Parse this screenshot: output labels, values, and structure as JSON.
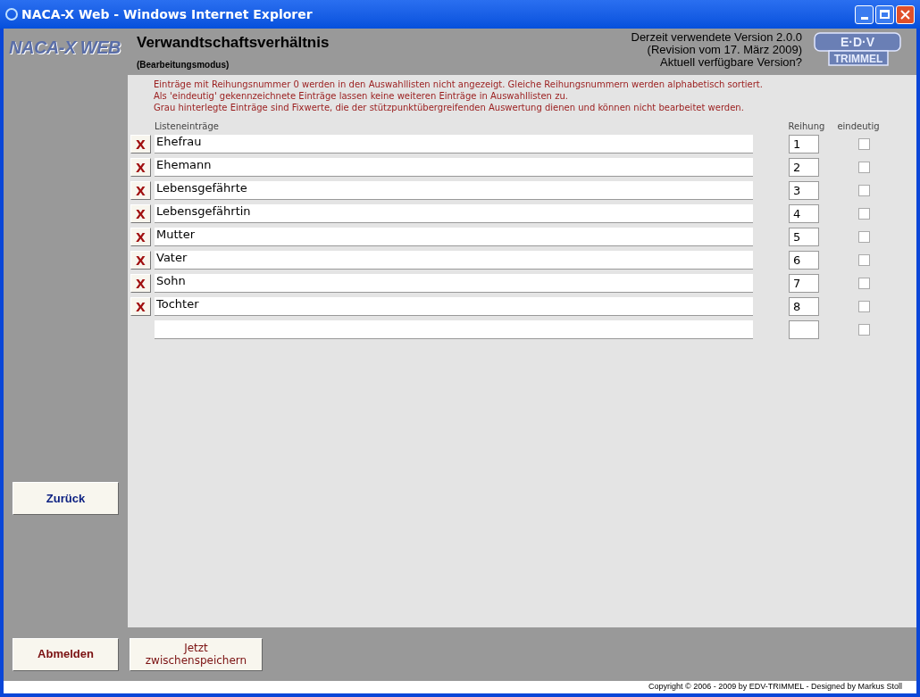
{
  "window": {
    "title": "NACA-X Web - Windows Internet Explorer"
  },
  "header": {
    "logo": "NACA-X WEB",
    "title": "Verwandtschaftsverhältnis",
    "subtitle": "(Bearbeitungsmodus)",
    "version_lines": [
      "Derzeit verwendete Version 2.0.0",
      "(Revision vom 17. März 2009)",
      "Aktuell verfügbare Version?"
    ],
    "company_logo": {
      "top": "E·D·V",
      "bottom": "TRIMMEL"
    }
  },
  "notes": [
    "Einträge mit Reihungsnummer 0 werden in den Auswahllisten nicht angezeigt. Gleiche Reihungsnummern werden alphabetisch sortiert.",
    "Als 'eindeutig' gekennzeichnete Einträge lassen keine weiteren Einträge in Auswahllisten zu.",
    "Grau hinterlegte Einträge sind Fixwerte, die der stützpunktübergreifenden Auswertung dienen und können nicht bearbeitet werden."
  ],
  "table": {
    "columns": [
      "Listeneinträge",
      "Reihung",
      "eindeutig"
    ],
    "rows": [
      {
        "delete": "X",
        "entry": "Ehefrau",
        "rank": "1",
        "unique": false
      },
      {
        "delete": "X",
        "entry": "Ehemann",
        "rank": "2",
        "unique": false
      },
      {
        "delete": "X",
        "entry": "Lebensgefährte",
        "rank": "3",
        "unique": false
      },
      {
        "delete": "X",
        "entry": "Lebensgefährtin",
        "rank": "4",
        "unique": false
      },
      {
        "delete": "X",
        "entry": "Mutter",
        "rank": "5",
        "unique": false
      },
      {
        "delete": "X",
        "entry": "Vater",
        "rank": "6",
        "unique": false
      },
      {
        "delete": "X",
        "entry": "Sohn",
        "rank": "7",
        "unique": false
      },
      {
        "delete": "X",
        "entry": "Tochter",
        "rank": "8",
        "unique": false
      },
      {
        "unique": false
      }
    ]
  },
  "buttons": {
    "back": "Zurück",
    "logout": "Abmelden",
    "save": "Jetzt zwischenspeichern"
  },
  "footer": "Copyright © 2006 - 2009 by EDV-TRIMMEL - Designed by Markus Stoll"
}
